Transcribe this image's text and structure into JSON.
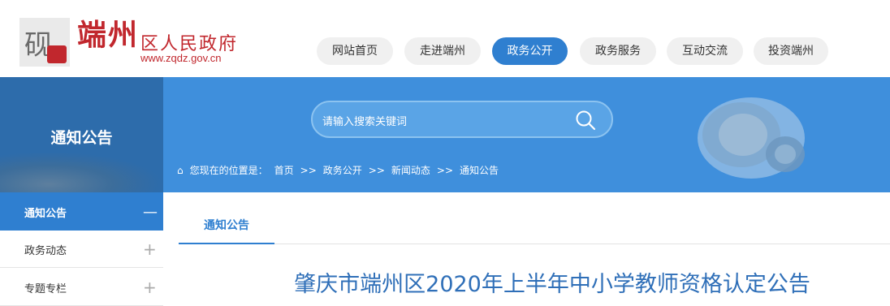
{
  "header": {
    "logo_char": "砚",
    "calligraphy": "端州",
    "gov_name": "区人民政府",
    "url": "www.zqdz.gov.cn"
  },
  "nav": {
    "items": [
      {
        "label": "网站首页",
        "active": false
      },
      {
        "label": "走进端州",
        "active": false
      },
      {
        "label": "政务公开",
        "active": true
      },
      {
        "label": "政务服务",
        "active": false
      },
      {
        "label": "互动交流",
        "active": false
      },
      {
        "label": "投资端州",
        "active": false
      }
    ]
  },
  "banner": {
    "section_title": "通知公告",
    "search_placeholder": "请输入搜索关键词",
    "breadcrumb": {
      "prefix": "您现在的位置是：",
      "items": [
        "首页",
        ">>",
        "政务公开",
        ">>",
        "新闻动态",
        ">>",
        "通知公告"
      ]
    }
  },
  "sidebar": {
    "active_label": "通知公告",
    "items": [
      {
        "label": "政务动态"
      },
      {
        "label": "专题专栏"
      }
    ]
  },
  "content": {
    "tab_label": "通知公告",
    "article_title": "肇庆市端州区2020年上半年中小学教师资格认定公告"
  },
  "colors": {
    "accent": "#2f7fd0",
    "banner": "#3f8fdc",
    "brand_red": "#c1272d"
  }
}
